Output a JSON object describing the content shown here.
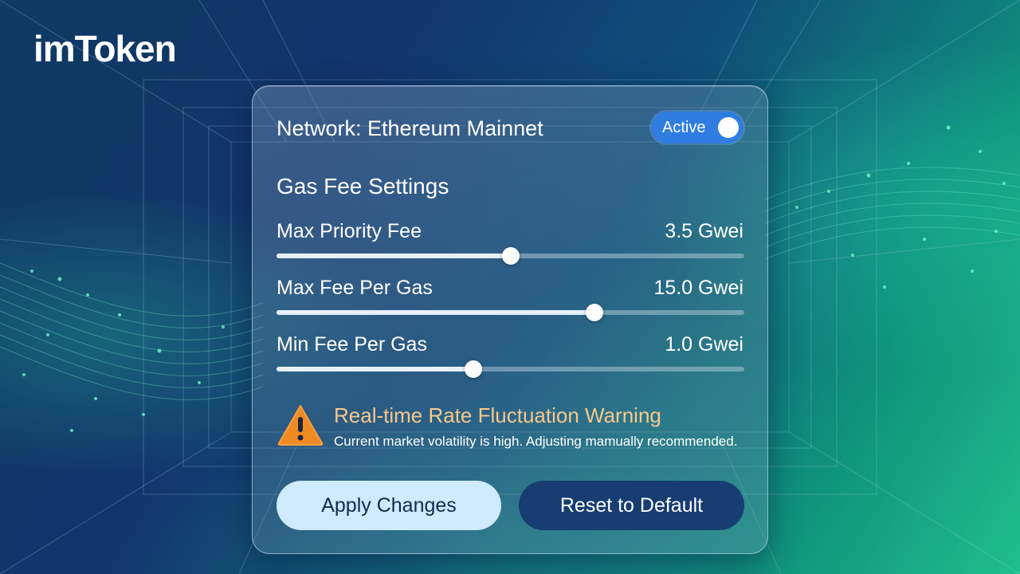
{
  "brand": {
    "logo": "imToken"
  },
  "network": {
    "label": "Network: Ethereum Mainnet",
    "toggle_label": "Active",
    "toggle_on": true,
    "toggle_color": "#2f7de0"
  },
  "gas": {
    "title": "Gas Fee Settings",
    "sliders": [
      {
        "label": "Max Priority Fee",
        "value": "3.5 Gwei",
        "level": 0.5
      },
      {
        "label": "Max Fee Per Gas",
        "value": "15.0 Gwei",
        "level": 0.68
      },
      {
        "label": "Min Fee Per Gas",
        "value": "1.0 Gwei",
        "level": 0.42
      }
    ]
  },
  "warning": {
    "icon": "warning-triangle-icon",
    "title": "Real-time Rate Fluctuation Warning",
    "text": "Current market volatility is high. Adjusting mamually recommended.",
    "color": "#f7c88a"
  },
  "actions": {
    "apply_label": "Apply Changes",
    "reset_label": "Reset to Default"
  },
  "colors": {
    "accent": "#2f7de0",
    "warning": "#f08a24",
    "apply_bg": "#cfe9fd",
    "reset_bg": "#173d73"
  }
}
